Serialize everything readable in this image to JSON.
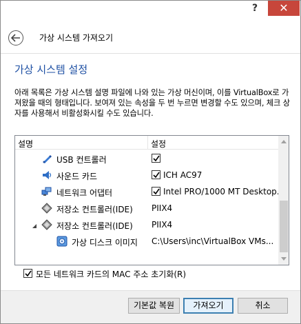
{
  "window": {
    "help_glyph": "?",
    "close_glyph": "✕"
  },
  "header": {
    "title": "가상 시스템 가져오기"
  },
  "page": {
    "title": "가상 시스템 설정",
    "description": "아래 목록은 가상 시스템 설명 파일에 나와 있는 가상 머신이며, 이를 VirtualBox로 가져왔을 때의 형태입니다. 보여져 있는 속성을 두 번 누르면 변경할 수도 있으며, 체크 상자를 사용해서 비활성화시킬 수도 있습니다."
  },
  "table": {
    "col_description": "설명",
    "col_setting": "설정",
    "rows": [
      {
        "icon": "usb-icon",
        "label": "USB 컨트롤러",
        "checked": true,
        "value": ""
      },
      {
        "icon": "audio-icon",
        "label": "사운드 카드",
        "checked": true,
        "value": "ICH AC97"
      },
      {
        "icon": "network-icon",
        "label": "네트워크 어댑터",
        "checked": true,
        "value": "Intel PRO/1000 MT Desktop..."
      },
      {
        "icon": "storage-controller-icon",
        "label": "저장소 컨트롤러(IDE)",
        "checked": false,
        "value": "PIIX4"
      },
      {
        "icon": "storage-controller-icon",
        "label": "저장소 컨트롤러(IDE)",
        "checked": false,
        "value": "PIIX4",
        "expanded": true
      },
      {
        "icon": "hard-disk-icon",
        "label": "가상 디스크 이미지",
        "checked": false,
        "value": "C:\\Users\\inc\\VirtualBox VMs..."
      }
    ]
  },
  "options": {
    "reset_mac_label": "모든 네트워크 카드의 MAC 주소 초기화(R)",
    "reset_mac_checked": true
  },
  "buttons": {
    "restore_defaults": "기본값 복원",
    "import": "가져오기",
    "cancel": "취소"
  },
  "colors": {
    "title_blue": "#1d4fa3",
    "close_red": "#c7463b"
  }
}
